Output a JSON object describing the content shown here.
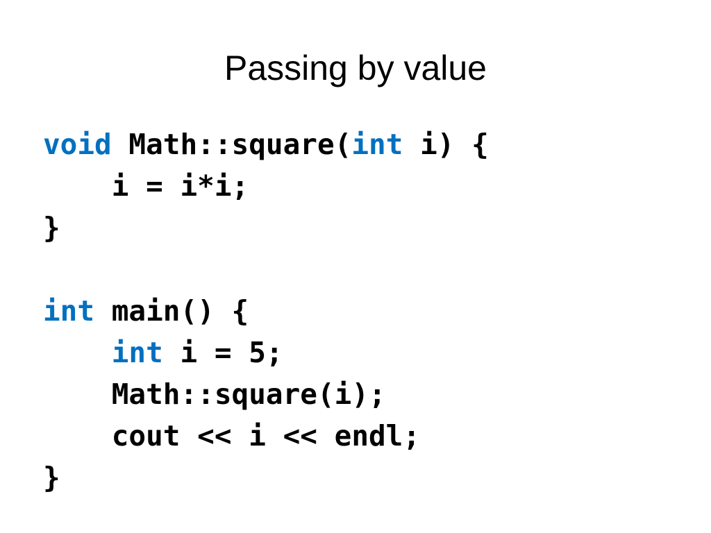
{
  "slide": {
    "title": "Passing by value",
    "keyword_color": "#0070c0",
    "code_lines": [
      [
        {
          "t": "void",
          "kw": true
        },
        {
          "t": " Math::square("
        },
        {
          "t": "int",
          "kw": true
        },
        {
          "t": " i) {"
        }
      ],
      [
        {
          "t": "    i = i*i;"
        }
      ],
      [
        {
          "t": "}"
        }
      ],
      [
        {
          "t": ""
        }
      ],
      [
        {
          "t": "int",
          "kw": true
        },
        {
          "t": " main() {"
        }
      ],
      [
        {
          "t": "    "
        },
        {
          "t": "int",
          "kw": true
        },
        {
          "t": " i = 5;"
        }
      ],
      [
        {
          "t": "    Math::square(i);"
        }
      ],
      [
        {
          "t": "    cout << i << endl;"
        }
      ],
      [
        {
          "t": "}"
        }
      ]
    ]
  }
}
